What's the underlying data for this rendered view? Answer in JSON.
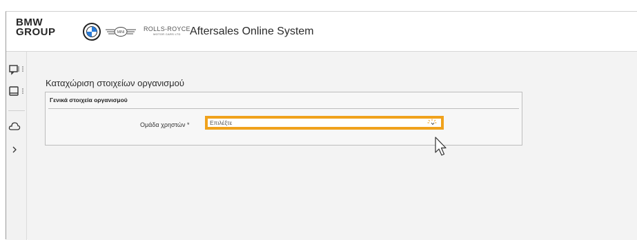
{
  "header": {
    "brand_line1": "BMW",
    "brand_line2": "GROUP",
    "rolls_royce": "ROLLS-ROYCE",
    "rolls_royce_sub": "MOTOR CARS LTD",
    "mini": "MINI",
    "app_title": "Aftersales Online System"
  },
  "sidenav": {
    "items": [
      {
        "icon": "chat-icon"
      },
      {
        "icon": "monitor-icon"
      },
      {
        "icon": "cloud-icon"
      },
      {
        "icon": "chevron-right-icon"
      }
    ]
  },
  "page": {
    "title": "Καταχώριση στοιχείων οργανισμού",
    "section_title": "Γενικά στοιχεία οργανισμού",
    "user_group_label": "Ομάδα χρηστών",
    "required_mark": "*",
    "user_group_placeholder": "Επιλέξτε"
  },
  "colors": {
    "highlight": "#f0a21c",
    "background": "#f3f3f3"
  }
}
